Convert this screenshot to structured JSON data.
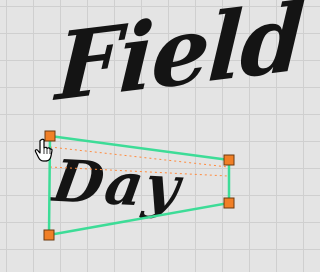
{
  "canvas": {
    "title_word": "Field",
    "subtitle_word": "Day"
  },
  "selection": {
    "frame_color": "#3ddc97",
    "guide_color": "#ff8a3d",
    "handle_color": "#f07f26",
    "handles": [
      "top-left",
      "top-right",
      "bottom-right",
      "bottom-left"
    ]
  },
  "cursor": {
    "icon": "hand-pointer-icon"
  }
}
